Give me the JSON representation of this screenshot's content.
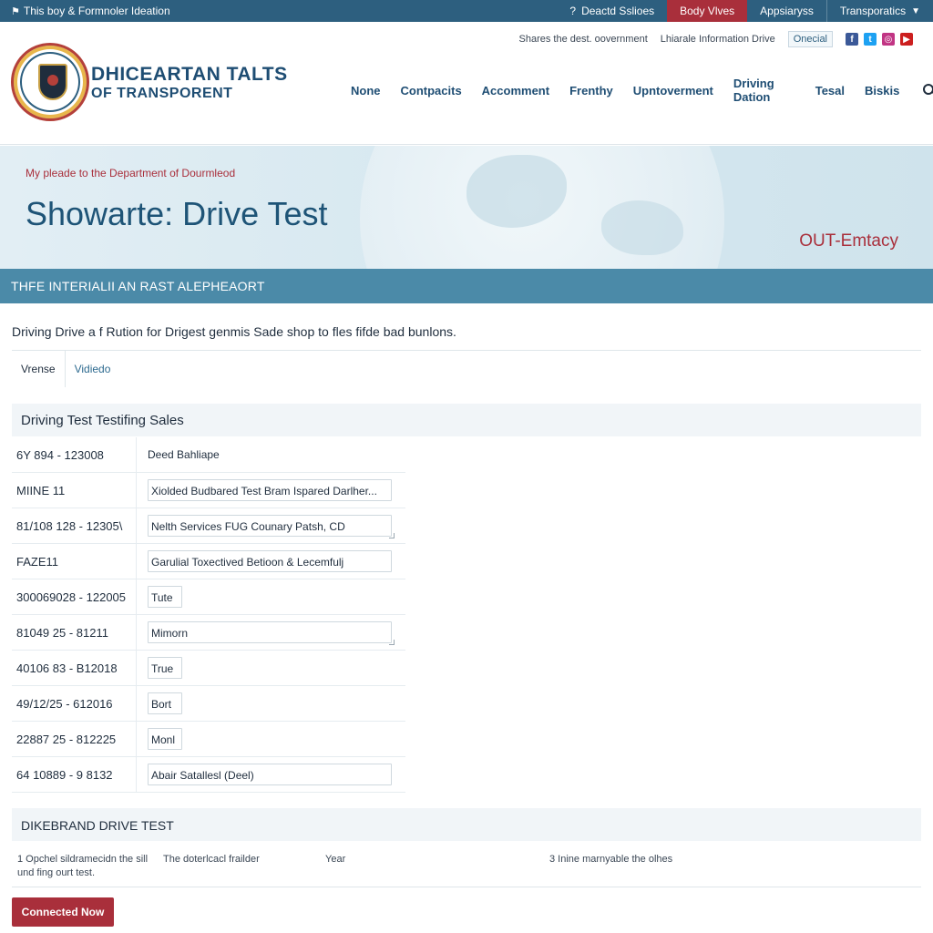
{
  "topbar": {
    "left_text": "This boy & Formnoler Ideation",
    "items": [
      "Deactd Sslioes",
      "Body Vlves",
      "Appsiaryss",
      "Transporatics"
    ]
  },
  "header": {
    "brand_line1": "DHICEARTAN TALTS",
    "brand_line2": "OF TRANSPORENT",
    "utility_links": [
      "Shares the dest. oovernment",
      "Lhiarale Information Drive"
    ],
    "utility_pill": "Onecial",
    "social": [
      "f",
      "t",
      "◎",
      "▶"
    ],
    "nav": [
      "None",
      "Contpacits",
      "Accomment",
      "Frenthy",
      "Upntoverment",
      "Driving Dation",
      "Tesal",
      "Biskis"
    ]
  },
  "hero": {
    "eyebrow": "My pleade to the Department of Dourmleod",
    "title": "Showarte: Drive Test",
    "tag": "OUT-Emtacy"
  },
  "band": {
    "title": "THFE INTERIALII AN RAST ALEPHEAORT"
  },
  "content": {
    "intro": "Driving Drive a f Rution for Drigest genmis Sade shop to fles fifde bad bunlons.",
    "tabs": [
      "Vrense",
      "Vidiedo"
    ],
    "panel_title": "Driving Test Testifing Sales",
    "rows": [
      {
        "key": "6Y 894 - 123008",
        "value": "Deed Bahliape",
        "kind": "text"
      },
      {
        "key": "MIINE 11",
        "value": "Xiolded Budbared Test Bram Ispared Darlher...",
        "kind": "wide"
      },
      {
        "key": "81/108 128 - 12305\\",
        "value": "Nelth Services FUG Counary Patsh, CD",
        "kind": "wide-ta"
      },
      {
        "key": "FAZE11",
        "value": "Garulial Toxectived Betioon & Lecemfulj",
        "kind": "wide"
      },
      {
        "key": "300069028 - 122005",
        "value": "Tute",
        "kind": "short"
      },
      {
        "key": "81049 25 - 81211",
        "value": "Mimorn",
        "kind": "wide-ta"
      },
      {
        "key": "40106 83 - B12018",
        "value": "True",
        "kind": "short"
      },
      {
        "key": "49/12/25 - 612016",
        "value": "Bort",
        "kind": "short"
      },
      {
        "key": "22887 25 - 812225",
        "value": "Monl",
        "kind": "short"
      },
      {
        "key": "64 10889 - 9 8132",
        "value": "Abair Satallesl (Deel)",
        "kind": "wide"
      }
    ],
    "panel2_title": "DIKEBRAND DRIVE TEST",
    "footer_cols": [
      "1 Opchel sildramecidn the sill und fing ourt test.",
      "The doterlcacl frailder",
      "Year",
      "3 Inine marnyable the olhes"
    ],
    "cta_label": "Connected Now"
  }
}
